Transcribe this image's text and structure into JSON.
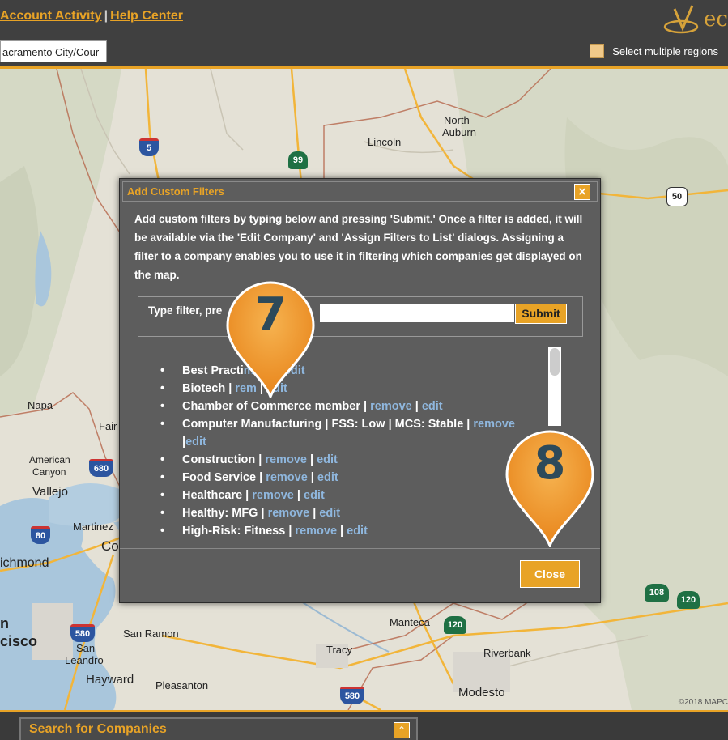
{
  "header": {
    "links": [
      "Account Activity",
      "Help Center"
    ],
    "separator": "|",
    "logo_text": "ec"
  },
  "subbar": {
    "region_value": "acramento City/Cour",
    "multi_region_label": "Select multiple regions"
  },
  "map": {
    "labels": {
      "north_auburn_1": "North",
      "north_auburn_2": "Auburn",
      "lincoln": "Lincoln",
      "napa": "Napa",
      "fair": "Fair",
      "american_canyon_1": "American",
      "american_canyon_2": "Canyon",
      "vallejo": "Vallejo",
      "martinez": "Martinez",
      "co": "Co",
      "richmond": "ichmond",
      "san_francisco_1": "n",
      "san_francisco_2": "cisco",
      "san_leandro_1": "San",
      "san_leandro_2": "Leandro",
      "san_ramon": "San Ramon",
      "hayward": "Hayward",
      "pleasanton": "Pleasanton",
      "tracy": "Tracy",
      "manteca": "Manteca",
      "riverbank": "Riverbank",
      "modesto": "Modesto"
    },
    "shields": {
      "i5": "5",
      "ca99": "99",
      "us50": "50",
      "i680": "680",
      "i80": "80",
      "i580a": "580",
      "ca120a": "120",
      "ca108": "108",
      "ca120b": "120",
      "i580b": "580"
    },
    "copyright": "©2018 MAPC"
  },
  "dialog": {
    "title": "Add Custom Filters",
    "close_x": "×",
    "description": "Add custom filters by typing below and pressing 'Submit.' Once a filter is added, it will be available via the 'Edit Company' and 'Assign Filters to List' dialogs. Assigning a filter to a company enables you to use it in filtering which companies get displayed on the map.",
    "filter_label": "Type filter, pre",
    "filter_value": "",
    "submit_label": "Submit",
    "filters": [
      {
        "name": "Best Practi",
        "sep1": "",
        "remove": "move",
        "sep2": " | ",
        "edit": "edit"
      },
      {
        "name": "Biotech",
        "sep1": " | ",
        "remove": "rem",
        "sep2": " | ",
        "edit": "edit"
      },
      {
        "name": "Chamber of Co",
        "sep1": "mmerce member | ",
        "remove": "remove",
        "sep2": " | ",
        "edit": "edit"
      },
      {
        "name": "Computer Manufacturing | FSS: Low | MCS: Stable",
        "sep1": " | ",
        "remove": "remove",
        "sep2": " |",
        "edit": "edit"
      },
      {
        "name": "Construction",
        "sep1": " | ",
        "remove": "remove",
        "sep2": " | ",
        "edit": "edit"
      },
      {
        "name": "Food Service",
        "sep1": " | ",
        "remove": "remove",
        "sep2": " | ",
        "edit": "edit"
      },
      {
        "name": "Healthcare",
        "sep1": " | ",
        "remove": "remove",
        "sep2": " | ",
        "edit": "edit"
      },
      {
        "name": "Healthy: MFG",
        "sep1": " | ",
        "remove": "remove",
        "sep2": " | ",
        "edit": "edit"
      },
      {
        "name": "High-Risk: Fitness",
        "sep1": " | ",
        "remove": "remove",
        "sep2": " | ",
        "edit": "edit"
      }
    ],
    "close_label": "Close"
  },
  "callouts": [
    {
      "number": "7",
      "color": "#f0932b"
    },
    {
      "number": "8",
      "color": "#f0932b"
    }
  ],
  "bottom_panel": {
    "title": "Search for Companies"
  },
  "colors": {
    "accent": "#e8a326",
    "link": "#8fb7de",
    "dialog_bg": "#5d5d5d",
    "callout": "#f0932b"
  }
}
